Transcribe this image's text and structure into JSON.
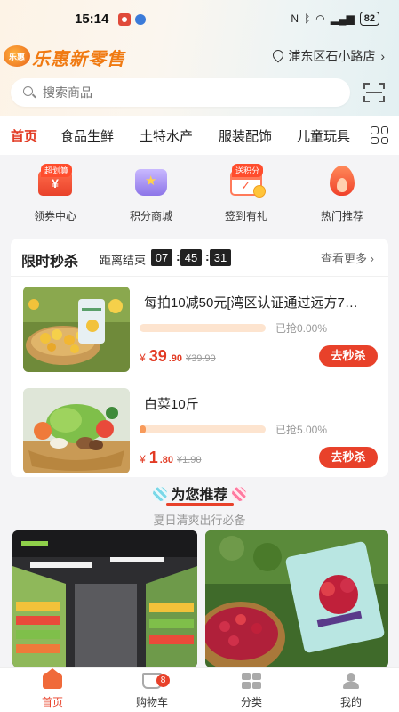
{
  "status_bar": {
    "time": "15:14",
    "battery": "82"
  },
  "header": {
    "logo_text": "乐惠新零售",
    "location": "浦东区石小路店",
    "chevron": "›"
  },
  "search": {
    "placeholder": "搜索商品"
  },
  "categories": [
    "首页",
    "食品生鲜",
    "土特水产",
    "服装配饰",
    "儿童玩具"
  ],
  "quick_links": [
    {
      "label": "领券中心",
      "tag": "超划算",
      "icon": "coupon-icon"
    },
    {
      "label": "积分商城",
      "icon": "points-mall-icon"
    },
    {
      "label": "签到有礼",
      "tag": "送积分",
      "icon": "checkin-calendar-icon"
    },
    {
      "label": "热门推荐",
      "icon": "hot-flame-icon"
    }
  ],
  "flash_sale": {
    "title": "限时秒杀",
    "countdown_label": "距离结束",
    "countdown": {
      "h": "07",
      "m": "45",
      "s": "31"
    },
    "more": "查看更多",
    "products": [
      {
        "name": "每拍10减50元[湾区认证通过远方7…",
        "progress": 0.0,
        "sold": "已抢0.00%",
        "price_symbol": "¥",
        "price_int": "39",
        "price_dec": ".90",
        "original_price": "¥39.90",
        "button": "去秒杀"
      },
      {
        "name": "白菜10斤",
        "progress": 0.05,
        "sold": "已抢5.00%",
        "price_symbol": "¥",
        "price_int": "1",
        "price_dec": ".80",
        "original_price": "¥1.90",
        "button": "去秒杀"
      }
    ]
  },
  "recommend": {
    "title": "为您推荐",
    "subtitle": "夏日清爽出行必备"
  },
  "bottom_nav": [
    {
      "label": "首页",
      "active": true
    },
    {
      "label": "购物车",
      "badge": "8"
    },
    {
      "label": "分类"
    },
    {
      "label": "我的"
    }
  ],
  "colors": {
    "accent": "#e8412a",
    "logo": "#f07a12"
  }
}
